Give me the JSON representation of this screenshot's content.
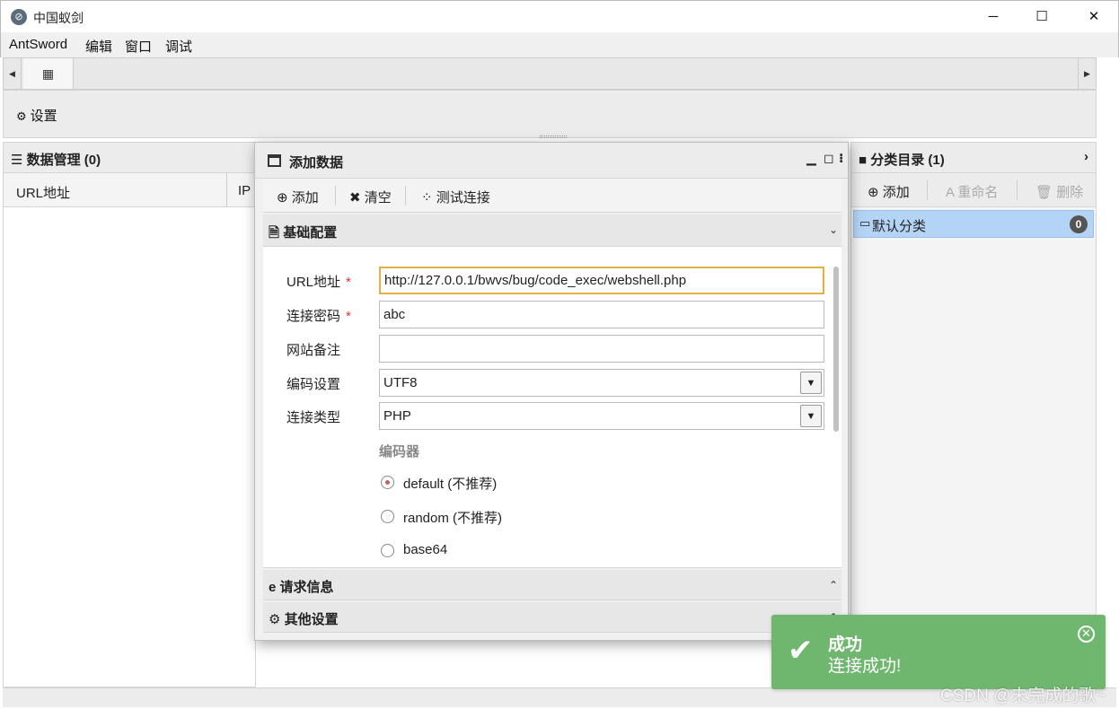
{
  "window": {
    "title": "中国蚁剑",
    "app_icon_glyph": "⊘",
    "minimize": "─",
    "maximize": "☐",
    "close": "✕"
  },
  "menu": [
    "AntSword",
    "编辑",
    "窗口",
    "调试"
  ],
  "tabbar": {
    "left_arrow": "◀",
    "right_arrow": "▶",
    "home_icon": "▦"
  },
  "settings": {
    "icon": "gear-icon",
    "glyph": "⚙",
    "label": "设置"
  },
  "data_panel": {
    "title": "☰ 数据管理 (0)",
    "columns": [
      "URL地址",
      "IP"
    ]
  },
  "category_panel": {
    "title": "■ 分类目录 (1)",
    "collapse": "›",
    "toolbar": {
      "add": "⊕ 添加",
      "rename": "A 重命名",
      "delete": "🗑 删除"
    },
    "items": [
      {
        "icon": "▭",
        "label": "默认分类",
        "count": "0"
      }
    ]
  },
  "dialog": {
    "title": "添加数据",
    "controls": {
      "minimize": "▁",
      "maximize": "◻",
      "more": "⁝"
    },
    "toolbar": {
      "add": "⊕ 添加",
      "clear": "✖ 清空",
      "test": "⁘ 测试连接"
    },
    "sections": {
      "basic": "🗎 基础配置",
      "request": "e 请求信息",
      "other": "⚙ 其他设置",
      "basic_arrow": "⌄",
      "request_arrow": "⌃",
      "other_arrow": "⌃"
    },
    "form": {
      "url_label": "URL地址",
      "url_value": "http://127.0.0.1/bwvs/bug/code_exec/webshell.php",
      "password_label": "连接密码",
      "password_value": "abc",
      "note_label": "网站备注",
      "note_value": "",
      "encoding_label": "编码设置",
      "encoding_value": "UTF8",
      "type_label": "连接类型",
      "type_value": "PHP",
      "required_mark": "*",
      "encoder_label": "编码器",
      "encoders": [
        {
          "label": "default (不推荐)",
          "checked": true
        },
        {
          "label": "random (不推荐)",
          "checked": false
        },
        {
          "label": "base64",
          "checked": false
        }
      ]
    }
  },
  "toast": {
    "title": "成功",
    "message": "连接成功!",
    "check": "✔",
    "close": "✕",
    "color": "#6fb66f"
  },
  "watermark": "CSDN @未完成的歌~"
}
